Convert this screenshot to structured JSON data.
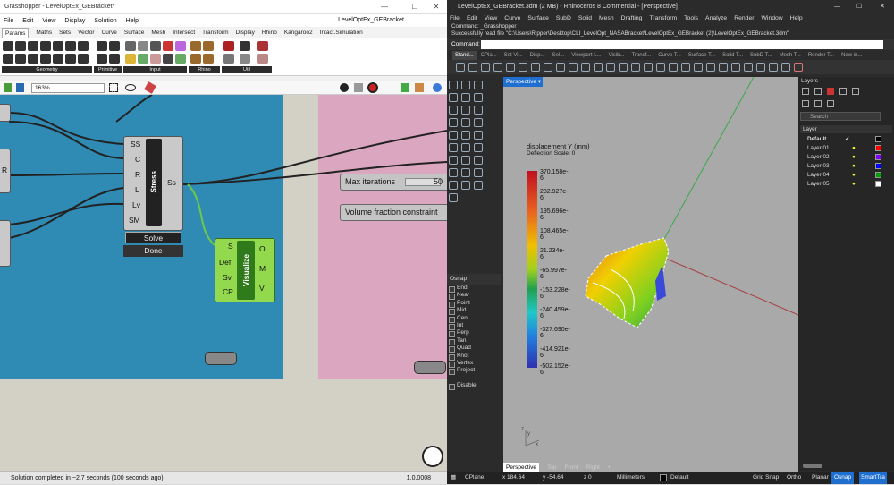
{
  "grasshopper": {
    "window_title": "Grasshopper - LevelOptEx_GEBracket*",
    "menu": [
      "File",
      "Edit",
      "View",
      "Display",
      "Solution",
      "Help"
    ],
    "doc_name": "LevelOptEx_GEBracket",
    "tabs": [
      "Params",
      "Maths",
      "Sets",
      "Vector",
      "Curve",
      "Surface",
      "Mesh",
      "Intersect",
      "Transform",
      "Display",
      "Rhino",
      "Kangaroo2",
      "Intact.Simulation"
    ],
    "panel_groups": [
      "Geometry",
      "Primitive",
      "Input",
      "Rhino",
      "Util"
    ],
    "zoom": "163%",
    "stress_component": {
      "inputs": [
        "SS",
        "C",
        "R",
        "L",
        "Lv",
        "SM"
      ],
      "output": "Ss",
      "name": "Stress",
      "solve_label": "Solve",
      "done_label": "Done"
    },
    "visualize_component": {
      "inputs": [
        "S",
        "Def",
        "Sv",
        "CP"
      ],
      "outputs": [
        "O",
        "M",
        "V"
      ],
      "name": "Visualize"
    },
    "max_iterations": {
      "label": "Max iterations",
      "value": "50"
    },
    "volume_fraction": {
      "label": "Volume fraction constraint"
    },
    "status": "Solution completed in ~2.7 seconds (100 seconds ago)",
    "version": "1.0.0008"
  },
  "rhino": {
    "window_title": "LevelOptEx_GEBracket.3dm (2 MB) - Rhinoceros 8 Commercial - [Perspective]",
    "menu": [
      "File",
      "Edit",
      "View",
      "Curve",
      "Surface",
      "SubD",
      "Solid",
      "Mesh",
      "Drafting",
      "Transform",
      "Tools",
      "Analyze",
      "Render",
      "Window",
      "Help"
    ],
    "history": [
      "Command: _Grasshopper",
      "Successfully read file \"C:\\Users\\Ripper\\Desktop\\CLI_LevelOpt_NASABracket\\LevelOptEx_GEBracket (2)\\LevelOptEx_GEBracket.3dm\""
    ],
    "command_label": "Command:",
    "toolbar_tabs": [
      "Stand...",
      "CPla...",
      "Set Vi...",
      "Disp...",
      "Sel...",
      "Viewport L...",
      "Visib...",
      "Transf...",
      "Curve T...",
      "Surface T...",
      "Solid T...",
      "SubD T...",
      "Mesh T...",
      "Render T...",
      "New in..."
    ],
    "viewport_name": "Perspective",
    "viewport_tabs": [
      "Perspective",
      "Top",
      "Front",
      "Right"
    ],
    "legend": {
      "title": "displacement Y (mm)",
      "subtitle": "Deflection Scale: 0",
      "values": [
        "370.158e-6",
        "282.927e-6",
        "195.696e-6",
        "108.465e-6",
        "21.234e-6",
        "-65.997e-6",
        "-153.228e-6",
        "-240.459e-6",
        "-327.690e-6",
        "-414.921e-6",
        "-502.152e-6"
      ]
    },
    "osnap_title": "Osnap",
    "osnap_items": [
      "End",
      "Near",
      "Point",
      "Mid",
      "Cen",
      "Int",
      "Perp",
      "Tan",
      "Quad",
      "Knot",
      "Vertex",
      "Project"
    ],
    "osnap_disable": "Disable",
    "layers_title": "Layers",
    "layers_search": "Search",
    "layers_header": "Layer",
    "layers": [
      {
        "name": "Default",
        "color": "#000000"
      },
      {
        "name": "Layer 01",
        "color": "#ff0000"
      },
      {
        "name": "Layer 02",
        "color": "#8000ff"
      },
      {
        "name": "Layer 03",
        "color": "#0000ff"
      },
      {
        "name": "Layer 04",
        "color": "#00a000"
      },
      {
        "name": "Layer 05",
        "color": "#ffffff"
      }
    ],
    "status": {
      "cplane": "CPlane",
      "x": "x 184.64",
      "y": "y -54.64",
      "z": "z 0",
      "units": "Millimeters",
      "layer": "Default",
      "grid_snap": "Grid Snap",
      "ortho": "Ortho",
      "planar": "Planar",
      "osnap": "Osnap",
      "smarttrack": "SmartTra"
    }
  }
}
